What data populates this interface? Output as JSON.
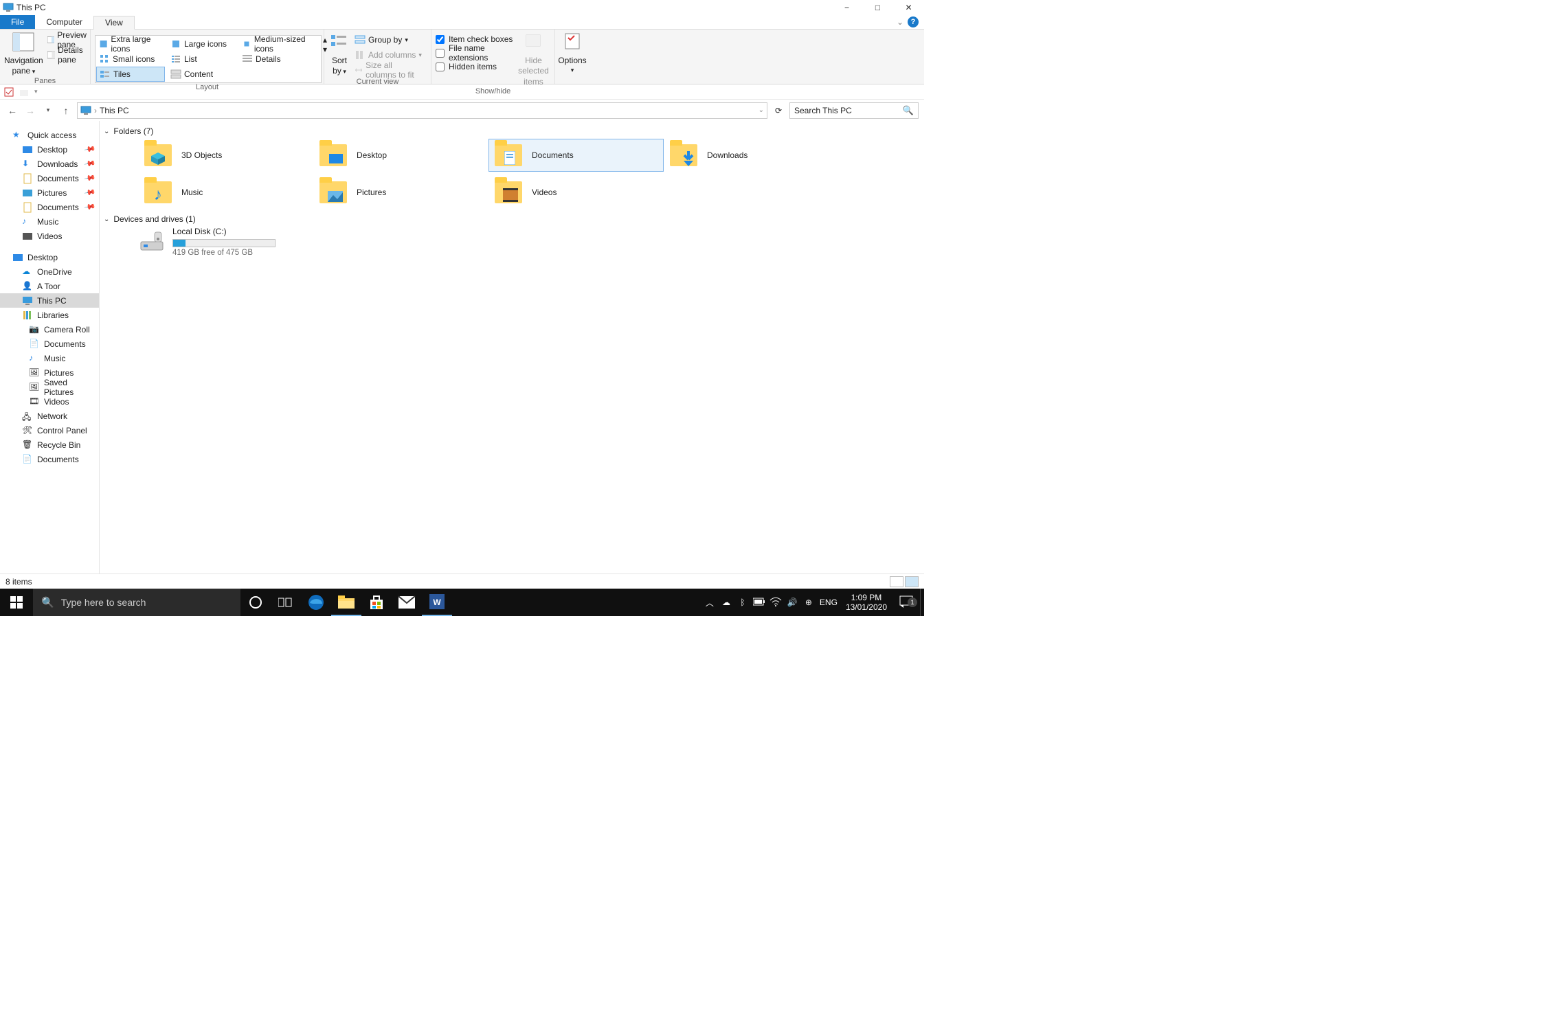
{
  "window": {
    "title": "This PC"
  },
  "tabs": {
    "file": "File",
    "computer": "Computer",
    "view": "View"
  },
  "ribbon": {
    "panes": {
      "nav": "Navigation pane",
      "preview": "Preview pane",
      "details": "Details pane",
      "group": "Panes"
    },
    "layout": {
      "xl": "Extra large icons",
      "large": "Large icons",
      "medium": "Medium-sized icons",
      "small": "Small icons",
      "list": "List",
      "details": "Details",
      "tiles": "Tiles",
      "content": "Content",
      "group": "Layout"
    },
    "current": {
      "sort": "Sort by",
      "groupby": "Group by",
      "addcols": "Add columns",
      "sizecols": "Size all columns to fit",
      "group": "Current view"
    },
    "showhide": {
      "checkboxes": "Item check boxes",
      "ext": "File name extensions",
      "hidden": "Hidden items",
      "hidesel": "Hide selected items",
      "group": "Show/hide"
    },
    "options": "Options"
  },
  "address": {
    "root": "This PC"
  },
  "search": {
    "placeholder": "Search This PC"
  },
  "sidebar": {
    "quick": "Quick access",
    "quick_items": [
      "Desktop",
      "Downloads",
      "Documents",
      "Pictures",
      "Documents",
      "Music",
      "Videos"
    ],
    "desktop": "Desktop",
    "onedrive": "OneDrive",
    "user": "A Toor",
    "thispc": "This PC",
    "libraries": "Libraries",
    "lib_items": [
      "Camera Roll",
      "Documents",
      "Music",
      "Pictures",
      "Saved Pictures",
      "Videos"
    ],
    "network": "Network",
    "cp": "Control Panel",
    "rb": "Recycle Bin",
    "docs": "Documents"
  },
  "sections": {
    "folders_hdr": "Folders (7)",
    "folders": [
      "3D Objects",
      "Desktop",
      "Documents",
      "Downloads",
      "Music",
      "Pictures",
      "Videos"
    ],
    "drives_hdr": "Devices and drives (1)",
    "drive": {
      "name": "Local Disk (C:)",
      "free": "419 GB free of 475 GB",
      "fill_pct": 12
    }
  },
  "status": {
    "items": "8 items"
  },
  "taskbar": {
    "search_placeholder": "Type here to search",
    "lang": "ENG",
    "time": "1:09 PM",
    "date": "13/01/2020",
    "notif_count": "1"
  }
}
